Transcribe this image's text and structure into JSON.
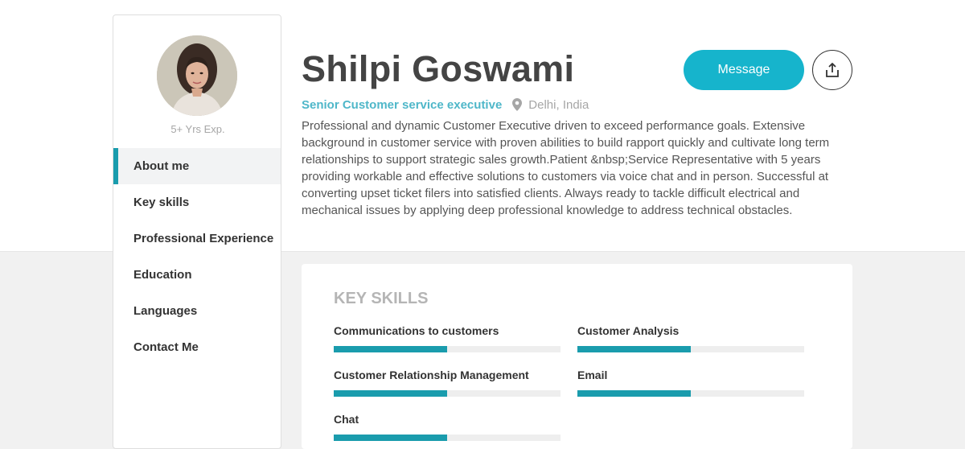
{
  "profile": {
    "name": "Shilpi Goswami",
    "title": "Senior Customer service executive",
    "location": "Delhi, India",
    "experience": "5+ Yrs Exp.",
    "bio": "Professional and dynamic Customer Executive driven to exceed performance goals. Extensive background in customer service with proven abilities to build rapport quickly and cultivate long term relationships to support strategic sales growth.Patient &nbsp;Service Representative with 5 years providing workable and effective solutions to customers via voice chat and in person. Successful at converting upset ticket filers into satisfied clients. Always ready to tackle difficult electrical and mechanical issues by applying deep professional knowledge to address technical obstacles."
  },
  "actions": {
    "message_label": "Message",
    "share_icon": "share-upload-icon"
  },
  "sidebar": {
    "avatar_icon": "profile-photo",
    "active_index": 0,
    "items": [
      {
        "label": "About me"
      },
      {
        "label": "Key skills"
      },
      {
        "label": "Professional Experience"
      },
      {
        "label": "Education"
      },
      {
        "label": "Languages"
      },
      {
        "label": "Contact Me"
      }
    ]
  },
  "skills": {
    "heading": "KEY SKILLS",
    "items": [
      {
        "label": "Communications to customers",
        "level": 0.5
      },
      {
        "label": "Customer Analysis",
        "level": 0.5
      },
      {
        "label": "Customer Relationship Management",
        "level": 0.5
      },
      {
        "label": "Email",
        "level": 0.5
      },
      {
        "label": "Chat",
        "level": 0.5
      }
    ]
  },
  "colors": {
    "accent": "#1a9cad",
    "button": "#16b4cc",
    "job_title": "#4fb7c9"
  }
}
